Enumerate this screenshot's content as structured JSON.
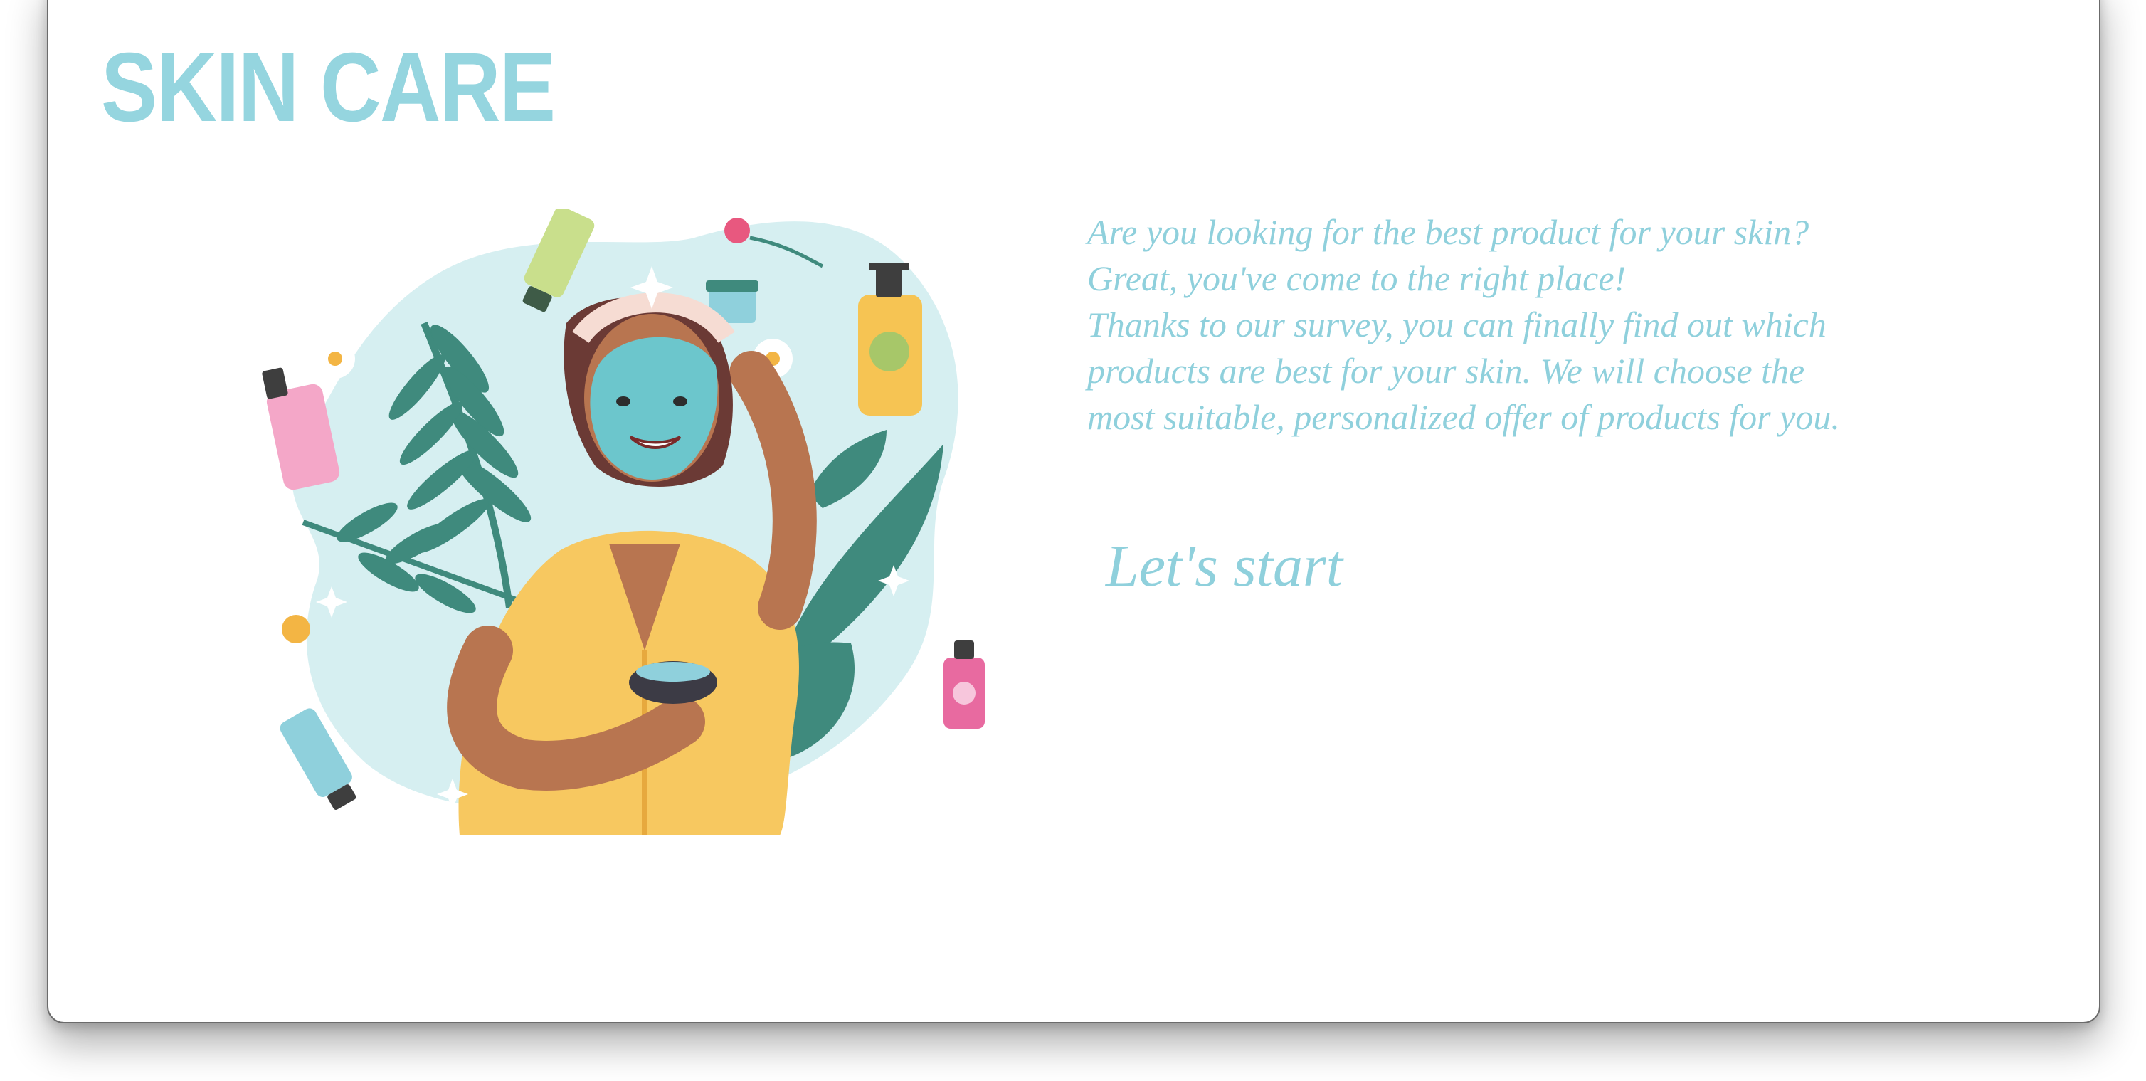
{
  "brand": {
    "title": "SKIN CARE"
  },
  "hero": {
    "illustration": "woman-with-face-mask-illustration",
    "intro_lines": [
      "Are you looking for the best product for your skin?",
      "Great, you've come to the right place!",
      "Thanks to our survey, you can finally find out which",
      "products are best for your skin. We will choose the",
      "most suitable, personalized offer of products for you."
    ],
    "start_label": "Let's start"
  },
  "colors": {
    "accent": "#8fd0dc",
    "logo": "#95d5df",
    "blob": "#d6eff1",
    "leaf": "#3f8a7d",
    "robe": "#f7c860",
    "skin": "#b87550",
    "mask": "#6cc6cc",
    "hair": "#6b3a35"
  }
}
